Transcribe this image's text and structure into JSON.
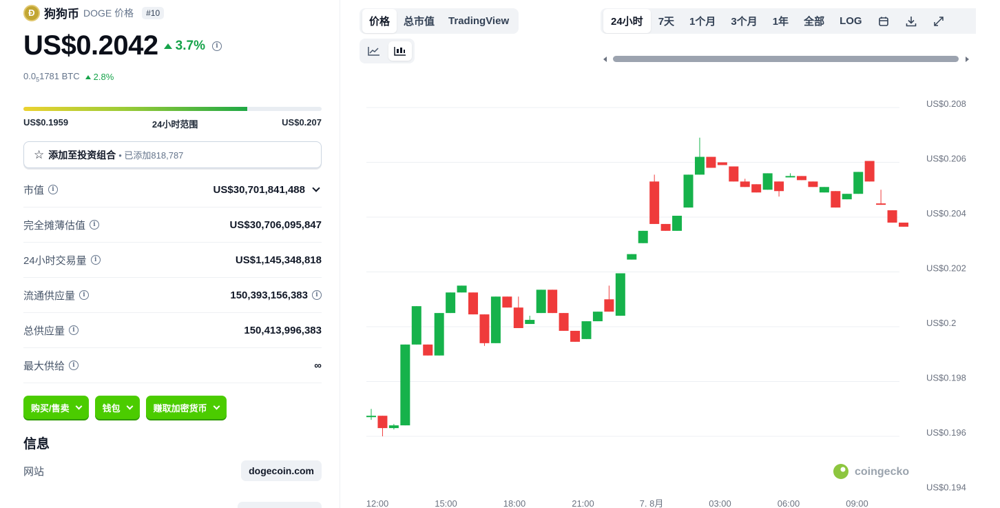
{
  "coin": {
    "name": "狗狗币",
    "symbol_label": "DOGE 价格",
    "rank": "#10",
    "price": "US$0.2042",
    "change_24h": "3.7%",
    "btc_price_prefix": "0.0",
    "btc_price_sub": "5",
    "btc_price_suffix": "1781 BTC",
    "btc_change": "2.8%"
  },
  "range_24h": {
    "low": "US$0.1959",
    "label": "24小时范围",
    "high": "US$0.207",
    "fill_fraction": 0.75
  },
  "portfolio": {
    "label": "添加至投资组合",
    "added": "• 已添加818,787"
  },
  "stats": [
    {
      "label": "市值",
      "value": "US$30,701,841,488",
      "dropdown": true,
      "value_info": false
    },
    {
      "label": "完全摊薄估值",
      "value": "US$30,706,095,847",
      "dropdown": false,
      "value_info": false
    },
    {
      "label": "24小时交易量",
      "value": "US$1,145,348,818",
      "dropdown": false,
      "value_info": false
    },
    {
      "label": "流通供应量",
      "value": "150,393,156,383",
      "dropdown": false,
      "value_info": true
    },
    {
      "label": "总供应量",
      "value": "150,413,996,383",
      "dropdown": false,
      "value_info": false
    },
    {
      "label": "最大供给",
      "value": "∞",
      "dropdown": false,
      "value_info": false
    }
  ],
  "actions": {
    "buy_sell": "购买/售卖",
    "wallet": "钱包",
    "earn": "赚取加密货币"
  },
  "info": {
    "title": "信息",
    "website_label": "网站",
    "website_value": "dogecoin.com"
  },
  "chart_tabs": [
    "价格",
    "总市值",
    "TradingView"
  ],
  "range_tabs": [
    "24小时",
    "7天",
    "1个月",
    "3个月",
    "1年",
    "全部",
    "LOG"
  ],
  "icons": {
    "line_chart": "line-chart-icon",
    "candle_chart": "candlestick-icon",
    "calendar": "calendar-icon",
    "download": "download-icon",
    "expand": "expand-icon"
  },
  "colors": {
    "up": "#16a34a",
    "candle_up": "#16b24b",
    "candle_down": "#ef3b3b",
    "accent_green": "#4bcc00"
  },
  "watermark": "coingecko",
  "chart_data": {
    "type": "candlestick",
    "y_ticks": [
      "US$0.208",
      "US$0.206",
      "US$0.204",
      "US$0.202",
      "US$0.2",
      "US$0.198",
      "US$0.196",
      "US$0.194"
    ],
    "y_tick_values": [
      0.208,
      0.206,
      0.204,
      0.202,
      0.2,
      0.198,
      0.196,
      0.194
    ],
    "x_ticks": [
      "12:00",
      "15:00",
      "18:00",
      "21:00",
      "7. 8月",
      "03:00",
      "06:00",
      "09:00"
    ],
    "ylim": [
      0.194,
      0.209
    ],
    "candles": [
      [
        0.19675,
        0.19675,
        0.197,
        0.1966
      ],
      [
        0.19675,
        0.1963,
        0.19675,
        0.196
      ],
      [
        0.1963,
        0.1964,
        0.19645,
        0.19625
      ],
      [
        0.1964,
        0.19935,
        0.19935,
        0.1964
      ],
      [
        0.19935,
        0.20075,
        0.20075,
        0.19935
      ],
      [
        0.19935,
        0.19895,
        0.19935,
        0.19895
      ],
      [
        0.19895,
        0.2005,
        0.2005,
        0.19895
      ],
      [
        0.2005,
        0.20125,
        0.20125,
        0.2005
      ],
      [
        0.20125,
        0.2015,
        0.2015,
        0.20125
      ],
      [
        0.20125,
        0.20045,
        0.20125,
        0.20045
      ],
      [
        0.20045,
        0.1994,
        0.20045,
        0.1993
      ],
      [
        0.1994,
        0.2011,
        0.2011,
        0.1994
      ],
      [
        0.2011,
        0.2007,
        0.2011,
        0.2007
      ],
      [
        0.2007,
        0.19995,
        0.2011,
        0.19995
      ],
      [
        0.2001,
        0.20025,
        0.2004,
        0.2001
      ],
      [
        0.2005,
        0.20135,
        0.20135,
        0.2005
      ],
      [
        0.20135,
        0.2005,
        0.20135,
        0.2005
      ],
      [
        0.2005,
        0.19985,
        0.2005,
        0.19985
      ],
      [
        0.19985,
        0.19945,
        0.19985,
        0.19945
      ],
      [
        0.19955,
        0.2002,
        0.2002,
        0.19955
      ],
      [
        0.2002,
        0.20055,
        0.20055,
        0.2002
      ],
      [
        0.201,
        0.20055,
        0.2015,
        0.20055
      ],
      [
        0.2004,
        0.20195,
        0.20195,
        0.2004
      ],
      [
        0.20245,
        0.20265,
        0.20265,
        0.20245
      ],
      [
        0.20305,
        0.2035,
        0.2035,
        0.20305
      ],
      [
        0.2053,
        0.20375,
        0.20555,
        0.20375
      ],
      [
        0.20375,
        0.2035,
        0.20375,
        0.2035
      ],
      [
        0.2035,
        0.20405,
        0.20405,
        0.2035
      ],
      [
        0.20435,
        0.20555,
        0.20555,
        0.20435
      ],
      [
        0.20555,
        0.2062,
        0.2069,
        0.20555
      ],
      [
        0.2062,
        0.2058,
        0.2062,
        0.2058
      ],
      [
        0.206,
        0.2059,
        0.206,
        0.2059
      ],
      [
        0.20585,
        0.2053,
        0.20585,
        0.2053
      ],
      [
        0.2053,
        0.2051,
        0.2054,
        0.2051
      ],
      [
        0.2052,
        0.2049,
        0.2052,
        0.2049
      ],
      [
        0.205,
        0.2056,
        0.2056,
        0.205
      ],
      [
        0.2053,
        0.20495,
        0.2053,
        0.20475
      ],
      [
        0.2055,
        0.2055,
        0.2056,
        0.20545
      ],
      [
        0.2055,
        0.20535,
        0.2055,
        0.20535
      ],
      [
        0.2053,
        0.2051,
        0.2053,
        0.2051
      ],
      [
        0.2049,
        0.2051,
        0.2051,
        0.2049
      ],
      [
        0.20495,
        0.20435,
        0.20495,
        0.20435
      ],
      [
        0.20465,
        0.20485,
        0.20485,
        0.20465
      ],
      [
        0.20485,
        0.20565,
        0.20565,
        0.20485
      ],
      [
        0.20605,
        0.2053,
        0.20605,
        0.2053
      ],
      [
        0.2045,
        0.20445,
        0.205,
        0.20445
      ],
      [
        0.20425,
        0.2038,
        0.20425,
        0.2038
      ],
      [
        0.2038,
        0.20365,
        0.2038,
        0.20365
      ]
    ],
    "grid": true
  }
}
